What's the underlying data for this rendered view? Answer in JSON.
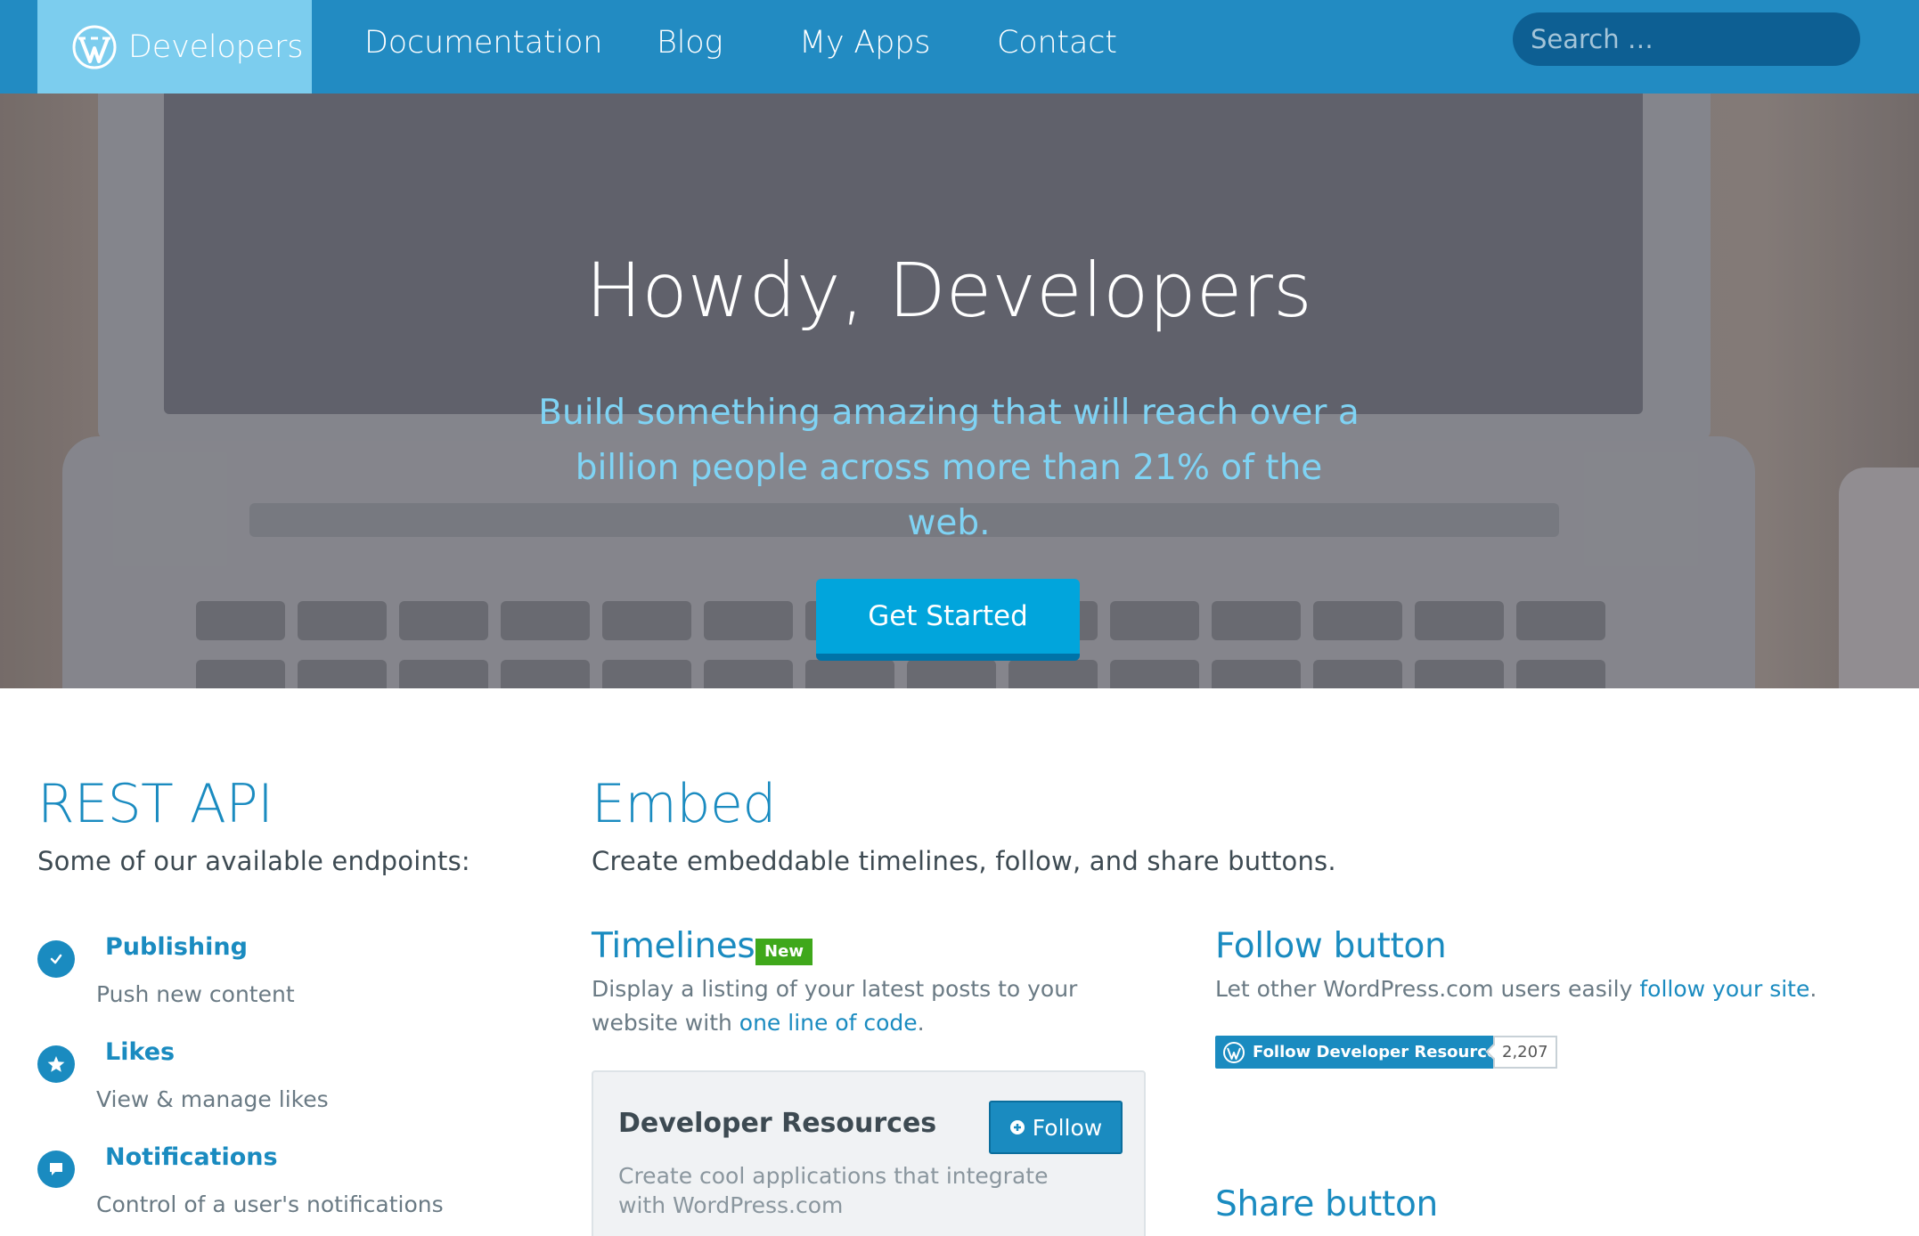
{
  "nav": {
    "brand_label": "Developers",
    "links": [
      "Documentation",
      "Blog",
      "My Apps",
      "Contact"
    ],
    "search_placeholder": "Search …"
  },
  "hero": {
    "title": "Howdy, Developers",
    "subtitle": "Build something amazing that will reach over a billion people across more than 21% of the web.",
    "cta_label": "Get Started"
  },
  "rest_api": {
    "title": "REST API",
    "subtitle": "Some of our available endpoints:",
    "endpoints": [
      {
        "name": "Publishing",
        "desc": "Push new content",
        "icon": "checkmark-icon"
      },
      {
        "name": "Likes",
        "desc": "View & manage likes",
        "icon": "star-icon"
      },
      {
        "name": "Notifications",
        "desc": "Control of a user's notifications",
        "icon": "speech-bubble-icon"
      }
    ]
  },
  "embed": {
    "title": "Embed",
    "subtitle": "Create embeddable timelines, follow, and share buttons.",
    "timelines": {
      "title": "Timelines",
      "badge": "New",
      "text_before": "Display a listing of your latest posts to your website with",
      "link": "one line of code",
      "text_after": "."
    },
    "widget": {
      "title": "Developer Resources",
      "follow_label": "Follow",
      "desc": "Create cool applications that integrate with WordPress.com"
    },
    "follow_button": {
      "title": "Follow button",
      "text_before": "Let other WordPress.com users easily",
      "link": "follow your site",
      "text_after": ".",
      "pill_label": "Follow Developer Resources",
      "count": "2,207"
    },
    "share_button": {
      "title": "Share button"
    }
  },
  "colors": {
    "nav_bg": "#228bc2",
    "brand_bg": "#7ccdee",
    "accent": "#1a8bc0",
    "cta": "#01a5dc",
    "badge_new": "#3fa81b"
  }
}
